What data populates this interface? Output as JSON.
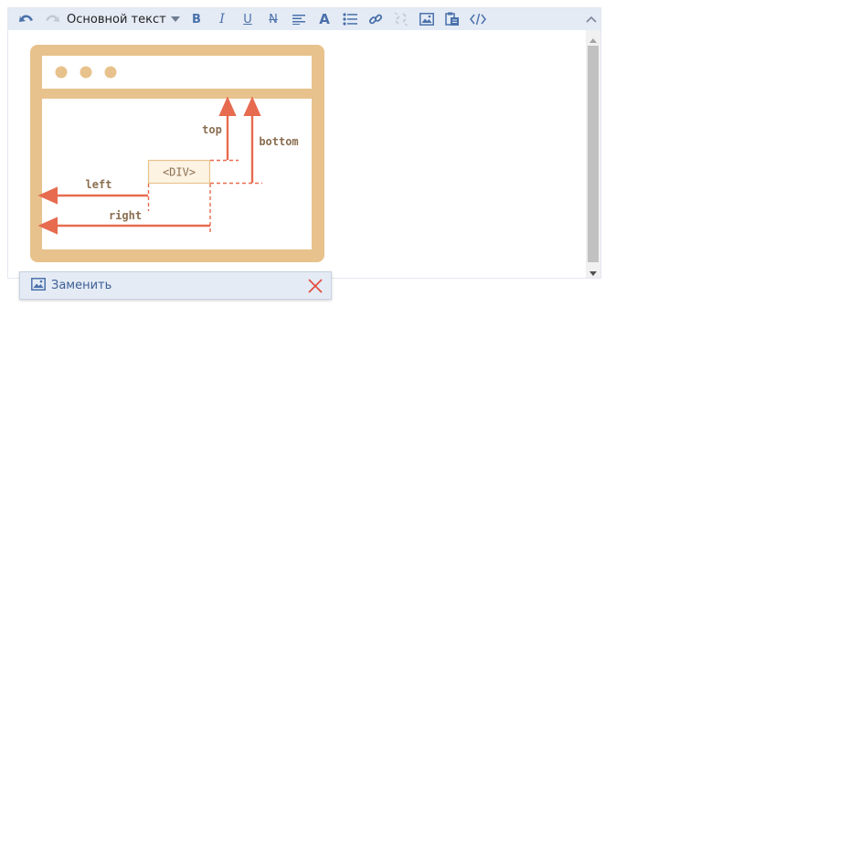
{
  "toolbar": {
    "format_label": "Основной текст",
    "bold_label": "B",
    "italic_label": "I",
    "underline_label": "U",
    "strike_label": "N",
    "fontcolor_label": "A",
    "icons": [
      "undo-icon",
      "redo-icon",
      "chevron-down-icon",
      "align-left-icon",
      "list-icon",
      "link-icon",
      "unlink-icon",
      "image-icon",
      "paste-icon",
      "code-icon",
      "chevron-up-icon"
    ]
  },
  "diagram": {
    "element_label": "<DIV>",
    "labels": {
      "top": "top",
      "bottom": "bottom",
      "left": "left",
      "right": "right"
    },
    "colors": {
      "frame": "#e8c28c",
      "arrow": "#e76b4f",
      "box_fill": "#fdf3e3",
      "text": "#8a6e50"
    }
  },
  "image_popup": {
    "replace_label": "Заменить",
    "close_icon": "close-icon"
  },
  "colors": {
    "toolbar_bg": "#e4ebf5",
    "icon": "#4a70ab",
    "close": "#e24b3b"
  }
}
